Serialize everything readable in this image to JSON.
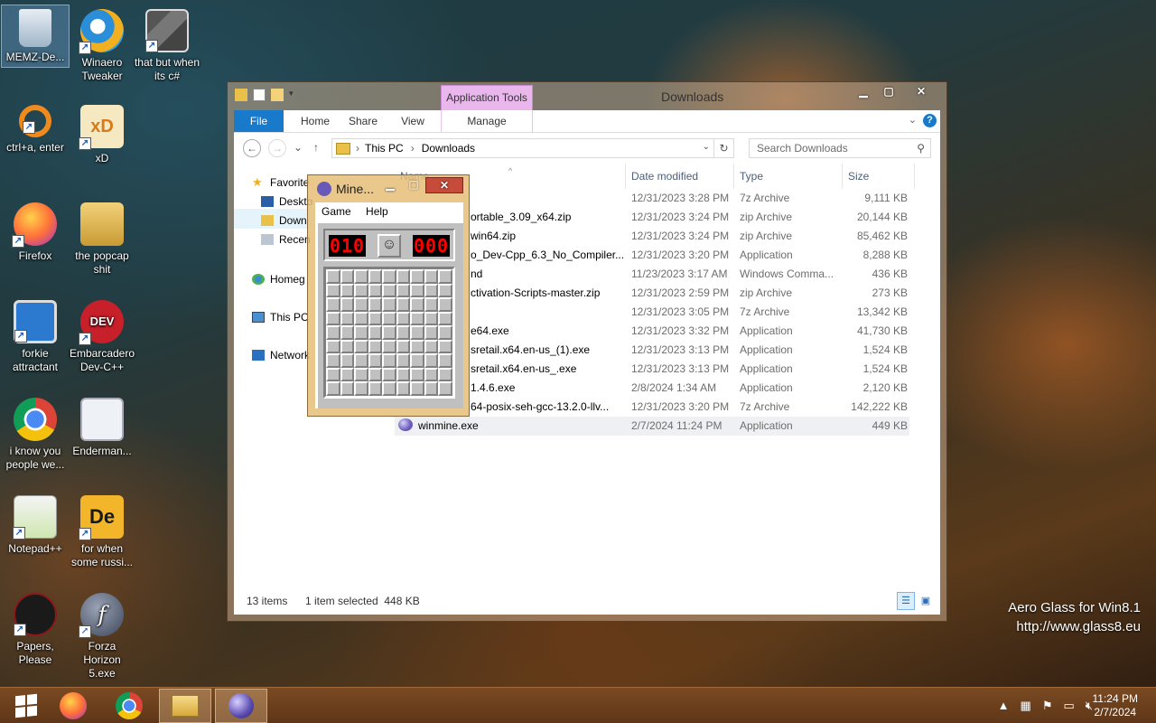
{
  "desktop": {
    "icons": [
      {
        "label": "MEMZ-De...",
        "icon": "recycle-bin-icon"
      },
      {
        "label": "Winaero Tweaker",
        "icon": "winaero-icon"
      },
      {
        "label": "that but when its c#",
        "icon": "stack-windows-icon"
      },
      {
        "label": "ctrl+a, enter",
        "icon": "orange-ring-icon"
      },
      {
        "label": "xD",
        "icon": "hxd-icon"
      },
      {
        "label": "Firefox",
        "icon": "firefox-icon"
      },
      {
        "label": "the popcap shit",
        "icon": "popcap-folder-icon"
      },
      {
        "label": "forkie attractant",
        "icon": "monitor-gear-icon"
      },
      {
        "label": "Embarcadero Dev-C++",
        "icon": "devcpp-icon"
      },
      {
        "label": "i know you people we...",
        "icon": "chrome-icon"
      },
      {
        "label": "Enderman...",
        "icon": "window-image-icon"
      },
      {
        "label": "Notepad++",
        "icon": "notepadpp-icon"
      },
      {
        "label": "for when some russi...",
        "icon": "de-icon"
      },
      {
        "label": "Papers, Please",
        "icon": "papers-please-icon"
      },
      {
        "label": "Forza Horizon 5.exe",
        "icon": "flash-icon"
      }
    ]
  },
  "explorer": {
    "title": "Downloads",
    "contextual_tab": "Application Tools",
    "tabs": {
      "file": "File",
      "home": "Home",
      "share": "Share",
      "view": "View",
      "manage": "Manage"
    },
    "breadcrumb": [
      "This PC",
      "Downloads"
    ],
    "search_placeholder": "Search Downloads",
    "nav": {
      "favorites": "Favorite",
      "desktop": "Deskto",
      "downloads": "Down",
      "recent": "Recen",
      "homegroup": "Homeg",
      "this_pc": "This PC",
      "network": "Network"
    },
    "columns": {
      "name": "Name",
      "date": "Date modified",
      "type": "Type",
      "size": "Size"
    },
    "files": [
      {
        "name": "",
        "date": "12/31/2023 3:28 PM",
        "type": "7z Archive",
        "size": "9,111 KB"
      },
      {
        "name": "ortable_3.09_x64.zip",
        "date": "12/31/2023 3:24 PM",
        "type": "zip Archive",
        "size": "20,144 KB"
      },
      {
        "name": "win64.zip",
        "date": "12/31/2023 3:24 PM",
        "type": "zip Archive",
        "size": "85,462 KB"
      },
      {
        "name": "o_Dev-Cpp_6.3_No_Compiler...",
        "date": "12/31/2023 3:20 PM",
        "type": "Application",
        "size": "8,288 KB"
      },
      {
        "name": "nd",
        "date": "11/23/2023 3:17 AM",
        "type": "Windows Comma...",
        "size": "436 KB"
      },
      {
        "name": "ctivation-Scripts-master.zip",
        "date": "12/31/2023 2:59 PM",
        "type": "zip Archive",
        "size": "273 KB"
      },
      {
        "name": "",
        "date": "12/31/2023 3:05 PM",
        "type": "7z Archive",
        "size": "13,342 KB"
      },
      {
        "name": "e64.exe",
        "date": "12/31/2023 3:32 PM",
        "type": "Application",
        "size": "41,730 KB"
      },
      {
        "name": "sretail.x64.en-us_(1).exe",
        "date": "12/31/2023 3:13 PM",
        "type": "Application",
        "size": "1,524 KB"
      },
      {
        "name": "sretail.x64.en-us_.exe",
        "date": "12/31/2023 3:13 PM",
        "type": "Application",
        "size": "1,524 KB"
      },
      {
        "name": "1.4.6.exe",
        "date": "2/8/2024 1:34 AM",
        "type": "Application",
        "size": "2,120 KB"
      },
      {
        "name": "64-posix-seh-gcc-13.2.0-llv...",
        "date": "12/31/2023 3:20 PM",
        "type": "7z Archive",
        "size": "142,222 KB"
      },
      {
        "name": "winmine.exe",
        "date": "2/7/2024 11:24 PM",
        "type": "Application",
        "size": "449 KB",
        "selected": true
      }
    ],
    "status": {
      "items": "13 items",
      "selected": "1 item selected  448 KB"
    }
  },
  "minesweeper": {
    "title": "Mine...",
    "menu": {
      "game": "Game",
      "help": "Help"
    },
    "mines_left": "010",
    "timer": "000",
    "face": "☺",
    "rows": 9,
    "cols": 9
  },
  "watermark": {
    "line1": "Aero Glass for Win8.1",
    "line2": "http://www.glass8.eu"
  },
  "taskbar": {
    "clock_time": "11:24 PM",
    "clock_date": "2/7/2024"
  },
  "colors": {
    "file_tab": "#1979ca",
    "app_tools": "#e9b7ec",
    "led_red": "#ff0000"
  }
}
